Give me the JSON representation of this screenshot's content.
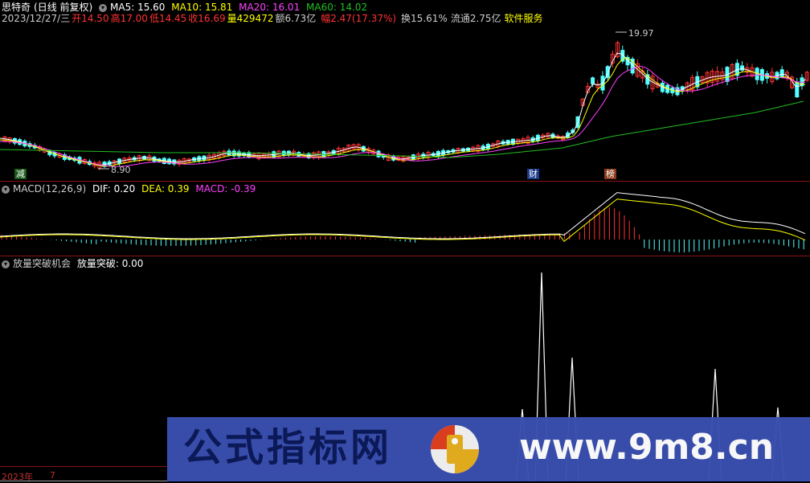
{
  "header": {
    "stock_name": "思特奇",
    "period": "(日线 前复权)",
    "ma5_label": "MA5: 15.60",
    "ma10_label": "MA10: 15.81",
    "ma20_label": "MA20: 16.01",
    "ma60_label": "MA60: 14.02"
  },
  "quote": {
    "date": "2023/12/27/三",
    "open": "开14.50",
    "high": "高17.00",
    "low": "低14.45",
    "close": "收16.69",
    "volume": "量429472",
    "amount": "额6.73亿",
    "change": "幅2.47(17.37%)",
    "turnover": "换15.61%",
    "float": "流通2.75亿",
    "industry": "软件服务"
  },
  "price_panel": {
    "high_marker": "19.97",
    "low_marker": "8.90",
    "tag_reduce": "减",
    "tag_finance": "财",
    "tag_rank": "榜"
  },
  "macd_panel": {
    "title": "MACD(12,26,9)",
    "dif": "DIF: 0.20",
    "dea": "DEA: 0.39",
    "macd": "MACD: -0.39"
  },
  "volume_panel": {
    "title": "放量突破机会",
    "value": "放量突破: 0.00"
  },
  "footer": {
    "year": "2023年",
    "month": "7"
  },
  "watermark": {
    "left_text": "公式指标网",
    "right_text": "www.9m8.cn"
  },
  "colors": {
    "up": "#ff3232",
    "down": "#54ffff",
    "ma5": "#ffffff",
    "ma10": "#ffff00",
    "ma20": "#ff40ff",
    "ma60": "#20c020",
    "separator": "#8a1414"
  },
  "icons": {
    "menu": "circle-chevron-icon"
  }
}
